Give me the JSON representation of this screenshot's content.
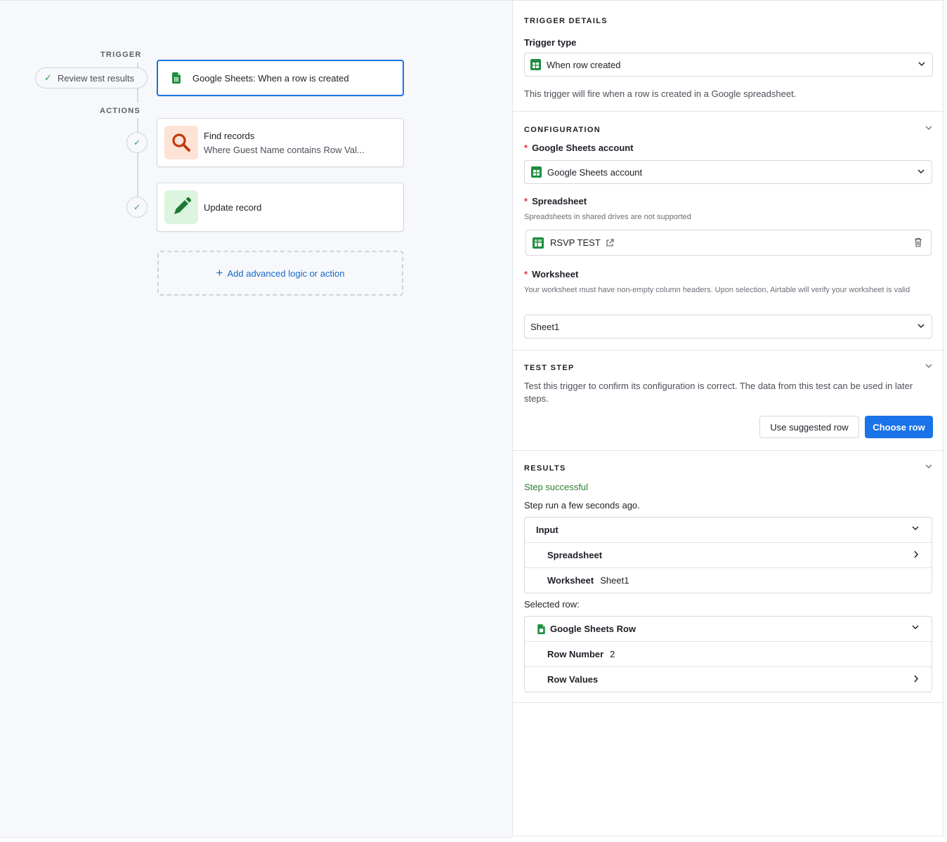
{
  "canvas": {
    "trigger_label": "TRIGGER",
    "actions_label": "ACTIONS",
    "review_pill": "Review test results",
    "trigger_card": {
      "title": "Google Sheets: When a row is created",
      "icon": "google-sheets-icon"
    },
    "actions": [
      {
        "title": "Find records",
        "subtitle": "Where Guest Name contains Row Val...",
        "icon": "search-icon",
        "status": "check-icon"
      },
      {
        "title": "Update record",
        "subtitle": "",
        "icon": "pencil-icon",
        "status": "check-icon"
      }
    ],
    "add_action": "Add advanced logic or action"
  },
  "panel": {
    "trigger_details": {
      "heading": "TRIGGER DETAILS",
      "field_label": "Trigger type",
      "value": "When row created",
      "description": "This trigger will fire when a row is created in a Google spreadsheet."
    },
    "configuration": {
      "heading": "CONFIGURATION",
      "account_label": "Google Sheets account",
      "account_value": "Google Sheets account",
      "spreadsheet_label": "Spreadsheet",
      "spreadsheet_hint": "Spreadsheets in shared drives are not supported",
      "spreadsheet_value": "RSVP TEST",
      "worksheet_label": "Worksheet",
      "worksheet_hint": "Your worksheet must have non-empty column headers. Upon selection, Airtable will verify your worksheet is valid",
      "worksheet_value": "Sheet1",
      "required_mark": "*"
    },
    "test_step": {
      "heading": "TEST STEP",
      "description": "Test this trigger to confirm its configuration is correct. The data from this test can be used in later steps.",
      "suggested_button": "Use suggested row",
      "choose_button": "Choose row"
    },
    "results": {
      "heading": "RESULTS",
      "status": "Step successful",
      "run_time": "Step run a few seconds ago.",
      "input_label": "Input",
      "input_rows": [
        {
          "key": "Spreadsheet",
          "value": ""
        },
        {
          "key": "Worksheet",
          "value": "Sheet1"
        }
      ],
      "selected_row_label": "Selected row:",
      "row_title": "Google Sheets Row",
      "row_fields": [
        {
          "key": "Row Number",
          "value": "2"
        },
        {
          "key": "Row Values",
          "value": ""
        }
      ]
    }
  },
  "colors": {
    "accent": "#1a73e8",
    "success": "#2f7d32",
    "required": "#d9363e",
    "sheets_green": "#1e8e3e"
  }
}
